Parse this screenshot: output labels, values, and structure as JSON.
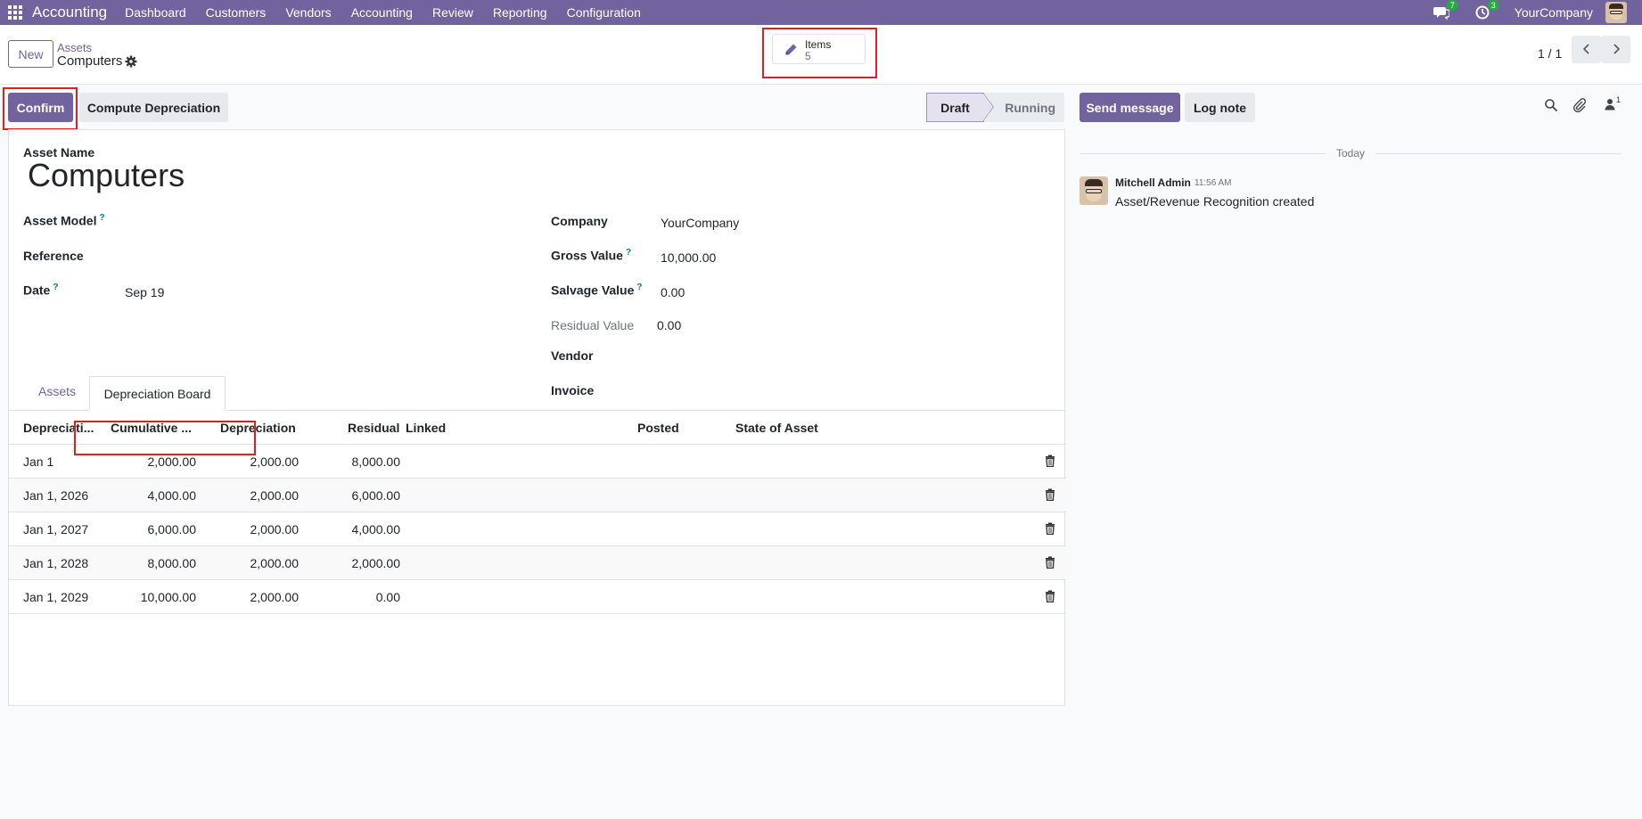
{
  "nav": {
    "app_name": "Accounting",
    "menu": [
      "Dashboard",
      "Customers",
      "Vendors",
      "Accounting",
      "Review",
      "Reporting",
      "Configuration"
    ],
    "messages_count": "7",
    "activities_count": "3",
    "company": "YourCompany"
  },
  "control_panel": {
    "new_label": "New",
    "breadcrumb_parent": "Assets",
    "breadcrumb_current": "Computers",
    "smart_button": {
      "label": "Items",
      "value": "5"
    },
    "pager": "1 / 1"
  },
  "status_bar": {
    "confirm_label": "Confirm",
    "compute_label": "Compute Depreciation",
    "stages": [
      "Draft",
      "Running"
    ],
    "active_stage": "Draft"
  },
  "form": {
    "asset_name_label": "Asset Name",
    "asset_name": "Computers",
    "left_fields": {
      "asset_model_label": "Asset Model",
      "reference_label": "Reference",
      "date_label": "Date",
      "date_value": "Sep 19"
    },
    "right_fields": {
      "company_label": "Company",
      "company_value": "YourCompany",
      "gross_label": "Gross Value",
      "gross_value": "10,000.00",
      "salvage_label": "Salvage Value",
      "salvage_value": "0.00",
      "residual_label": "Residual Value",
      "residual_value": "0.00",
      "vendor_label": "Vendor",
      "invoice_label": "Invoice"
    },
    "help_mark": "?"
  },
  "tabs": {
    "assets": "Assets",
    "board": "Depreciation Board"
  },
  "table": {
    "headers": [
      "Depreciati...",
      "Cumulative ...",
      "Depreciation",
      "Residual",
      "Linked",
      "Posted",
      "State of Asset"
    ],
    "rows": [
      {
        "date": "Jan 1",
        "cumulative": "2,000.00",
        "depreciation": "2,000.00",
        "residual": "8,000.00"
      },
      {
        "date": "Jan 1, 2026",
        "cumulative": "4,000.00",
        "depreciation": "2,000.00",
        "residual": "6,000.00"
      },
      {
        "date": "Jan 1, 2027",
        "cumulative": "6,000.00",
        "depreciation": "2,000.00",
        "residual": "4,000.00"
      },
      {
        "date": "Jan 1, 2028",
        "cumulative": "8,000.00",
        "depreciation": "2,000.00",
        "residual": "2,000.00"
      },
      {
        "date": "Jan 1, 2029",
        "cumulative": "10,000.00",
        "depreciation": "2,000.00",
        "residual": "0.00"
      }
    ]
  },
  "chatter": {
    "send_label": "Send message",
    "log_label": "Log note",
    "followers_count": "1",
    "date_separator": "Today",
    "message": {
      "author": "Mitchell Admin",
      "time": "11:56 AM",
      "body": "Asset/Revenue Recognition created"
    }
  },
  "colors": {
    "brand": "#71639e",
    "highlight": "#e0201e",
    "badge": "#28a745"
  }
}
